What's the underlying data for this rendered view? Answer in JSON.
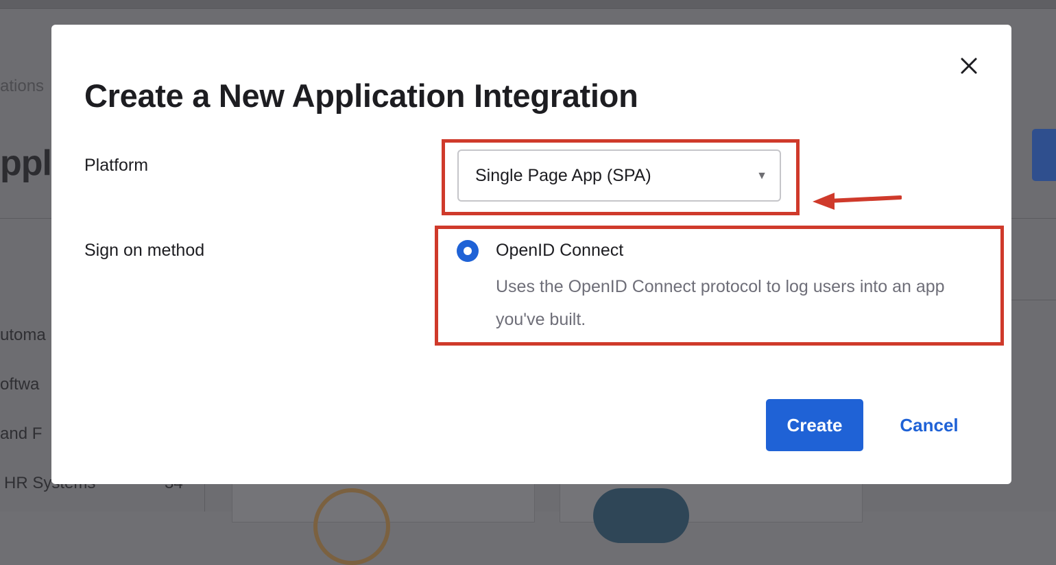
{
  "background": {
    "breadcrumb": "ations",
    "page_title": "ppl",
    "categories": [
      {
        "label": "utoma",
        "count": ""
      },
      {
        "label": "oftwa",
        "count": ""
      },
      {
        "label": "and F",
        "count": ""
      },
      {
        "label": "HR Systems",
        "count": "34"
      }
    ]
  },
  "modal": {
    "title": "Create a New Application Integration",
    "close_icon": "close-icon",
    "platform": {
      "label": "Platform",
      "selected": "Single Page App (SPA)",
      "caret": "▼"
    },
    "sign_on": {
      "label": "Sign on method",
      "option_label": "OpenID Connect",
      "option_description": "Uses the OpenID Connect protocol to log users into an app you've built.",
      "selected": true
    },
    "buttons": {
      "create": "Create",
      "cancel": "Cancel"
    }
  },
  "colors": {
    "accent": "#1f62d6",
    "annotation": "#cf3a2b",
    "overlay": "#6d6d71"
  }
}
